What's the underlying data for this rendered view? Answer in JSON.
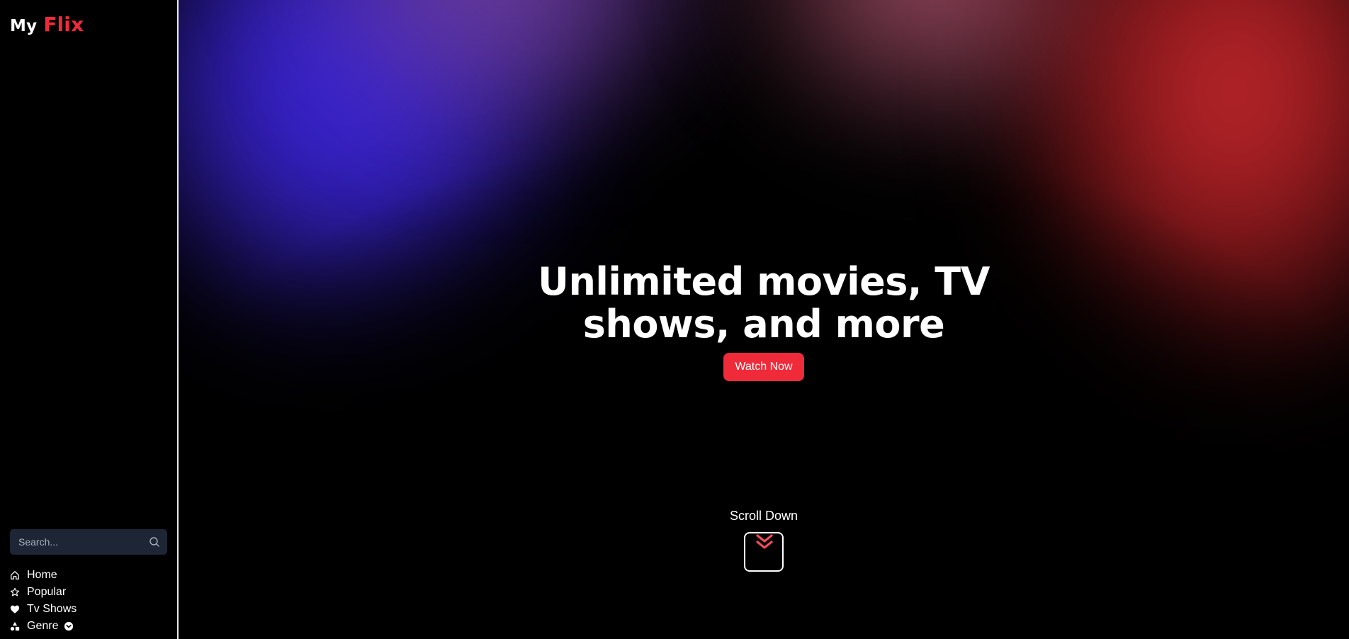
{
  "logo": {
    "part1": "My",
    "part2": "Flix"
  },
  "search": {
    "placeholder": "Search...",
    "icon": "search-icon"
  },
  "nav": {
    "items": [
      {
        "label": "Home",
        "icon": "home-icon"
      },
      {
        "label": "Popular",
        "icon": "star-icon"
      },
      {
        "label": "Tv Shows",
        "icon": "heart-icon"
      },
      {
        "label": "Genre",
        "icon": "shapes-icon",
        "trailing_icon": "chevron-down-circle-icon"
      }
    ]
  },
  "hero": {
    "headline": "Unlimited movies, TV shows, and more",
    "cta_label": "Watch Now"
  },
  "scroll": {
    "label": "Scroll Down",
    "icon": "double-chevron-down-icon"
  },
  "colors": {
    "accent": "#ef2b3a",
    "search_bg": "#1e2636",
    "background": "#000000",
    "hero_glow_left": "#3a24d8",
    "hero_glow_right": "#c92a2e"
  }
}
